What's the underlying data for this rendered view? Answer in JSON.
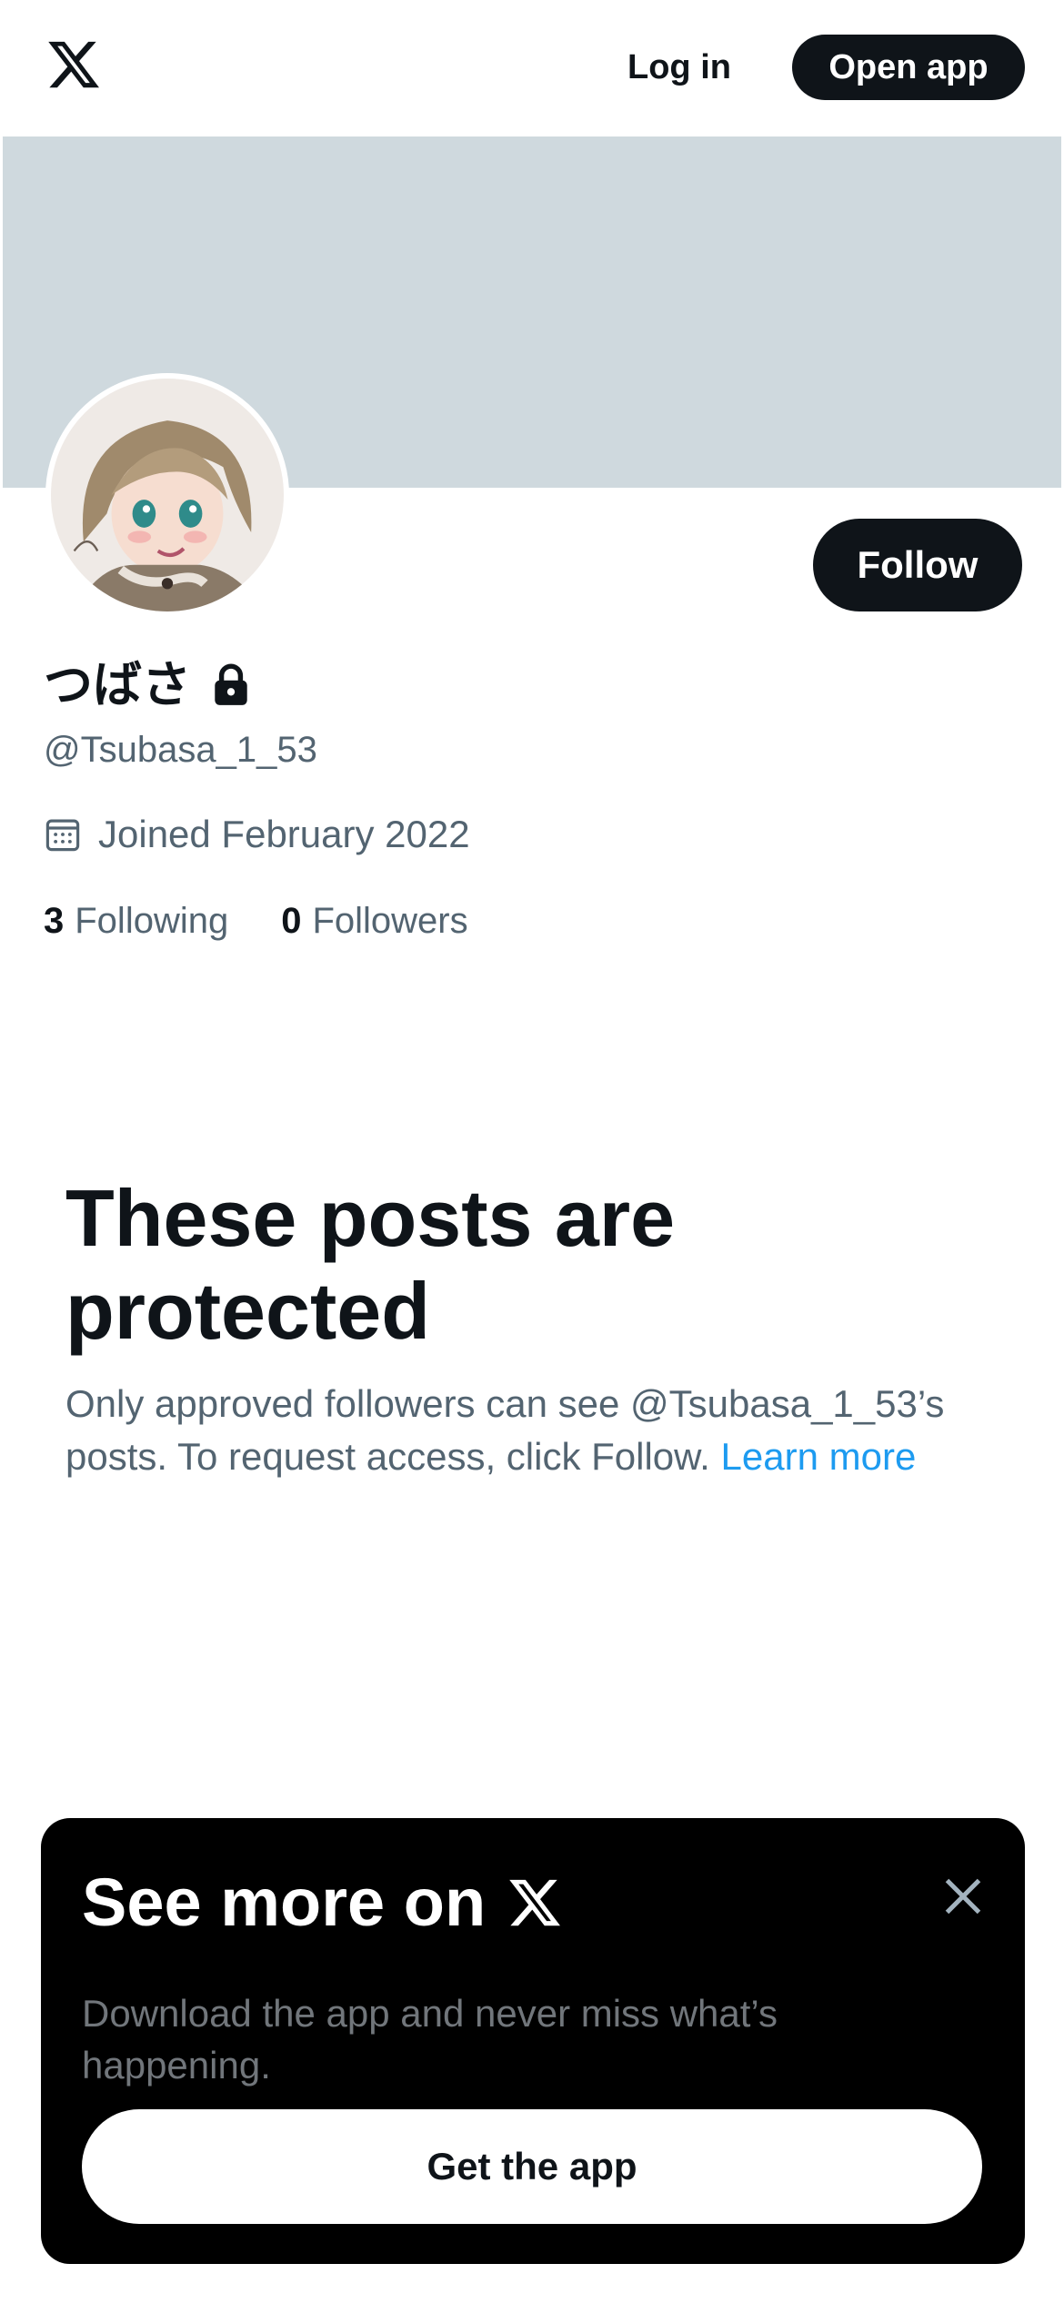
{
  "header": {
    "logo_icon": "x-logo-icon",
    "login_label": "Log in",
    "open_app_label": "Open app"
  },
  "profile": {
    "banner_color": "#cfd9de",
    "avatar_icon": "profile-avatar",
    "follow_label": "Follow",
    "display_name": "つばさ",
    "protected_icon": "lock-icon",
    "handle": "@Tsubasa_1_53",
    "joined_icon": "calendar-icon",
    "joined_text": "Joined February 2022",
    "following_count": "3",
    "following_label": "Following",
    "followers_count": "0",
    "followers_label": "Followers"
  },
  "protected": {
    "title": "These posts are protected",
    "text": "Only approved followers can see @Tsubasa_1_53’s posts. To request access, click Follow.",
    "learn_more_label": "Learn more"
  },
  "promo": {
    "title": "See more on",
    "logo_icon": "x-logo-icon",
    "close_icon": "close-icon",
    "text": "Download the app and never miss what’s happening.",
    "cta_label": "Get the app"
  },
  "colors": {
    "text_primary": "#0f1419",
    "text_secondary": "#536471",
    "link": "#1d9bf0",
    "button_dark": "#0f1419",
    "promo_bg": "#000000"
  }
}
